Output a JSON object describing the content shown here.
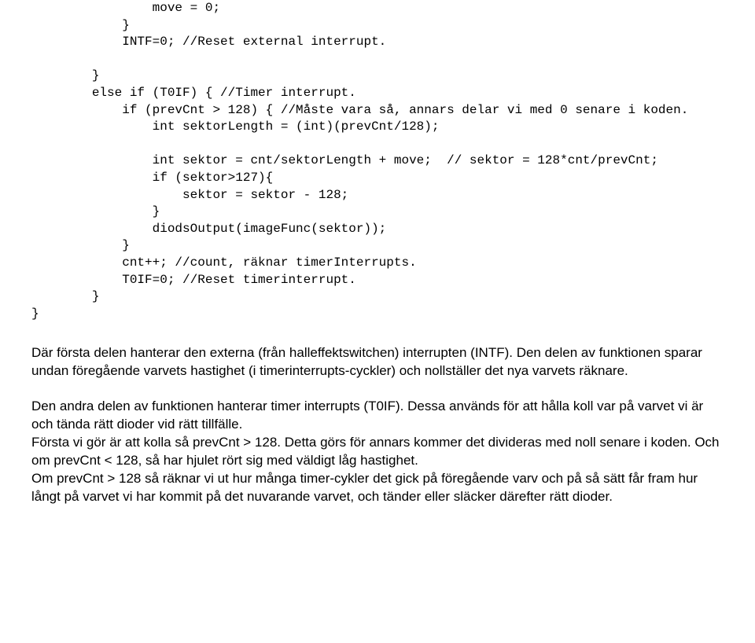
{
  "code": {
    "line1": "                move = 0;",
    "line2": "            }",
    "line3": "            INTF=0; //Reset external interrupt.",
    "line4": "",
    "line5": "        }",
    "line6": "        else if (T0IF) { //Timer interrupt.",
    "line7": "            if (prevCnt > 128) { //Måste vara så, annars delar vi med 0 senare i koden.",
    "line8": "                int sektorLength = (int)(prevCnt/128);",
    "line9": "",
    "line10": "                int sektor = cnt/sektorLength + move;  // sektor = 128*cnt/prevCnt;",
    "line11": "                if (sektor>127){",
    "line12": "                    sektor = sektor - 128;",
    "line13": "                }",
    "line14": "                diodsOutput(imageFunc(sektor));",
    "line15": "            }",
    "line16": "            cnt++; //count, räknar timerInterrupts.",
    "line17": "            T0IF=0; //Reset timerinterrupt.",
    "line18": "        }",
    "line19": "}"
  },
  "prose": {
    "p1": "Där första delen hanterar den externa (från halleffektswitchen) interrupten (INTF). Den delen av funktionen sparar undan föregående varvets hastighet (i timerinterrupts-cyckler) och nollställer det nya varvets räknare.",
    "p2": "Den andra delen av funktionen hanterar timer interrupts (T0IF). Dessa används för att hålla koll var på varvet vi är och tända rätt dioder vid rätt tillfälle.\nFörsta vi gör är att kolla så prevCnt > 128. Detta görs för annars kommer det divideras med noll senare i koden. Och om prevCnt < 128, så har hjulet rört sig med väldigt låg hastighet.\nOm prevCnt > 128 så räknar vi ut hur många timer-cykler det gick på föregående varv och på så sätt får fram hur långt på varvet vi har kommit på det nuvarande varvet, och tänder eller släcker därefter rätt dioder."
  }
}
